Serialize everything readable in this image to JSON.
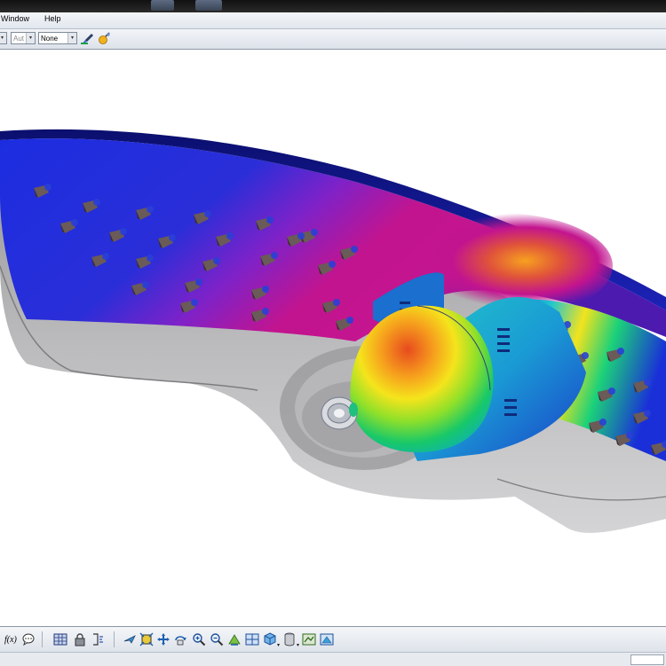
{
  "menu": {
    "window_label": "Window",
    "help_label": "Help"
  },
  "toolbar": {
    "auto_combo_value": "Aut",
    "none_combo_value": "None",
    "icons": [
      "paint-brush-icon",
      "lighting-icon"
    ]
  },
  "bottom_toolbar": {
    "formula_label": "f(x)",
    "icons": [
      "formula-icon",
      "comment-icon",
      "grid-icon",
      "lock-icon",
      "parameters-icon",
      "fly-mode-icon",
      "fit-all-icon",
      "pan-icon",
      "rotate-icon",
      "zoom-in-icon",
      "zoom-out-icon",
      "normal-view-icon",
      "multi-view-icon",
      "iso-view-icon",
      "shading-icon",
      "hide-show-icon",
      "swap-visible-space-icon",
      "shading-materials-icon"
    ]
  },
  "colors": {
    "heat_low": "#1a26e8",
    "heat_mid": "#1fd26c",
    "heat_warm": "#f5e61c",
    "heat_high": "#e63a1e",
    "heat_peak": "#c2148f",
    "housing": "#a9a9ab"
  }
}
